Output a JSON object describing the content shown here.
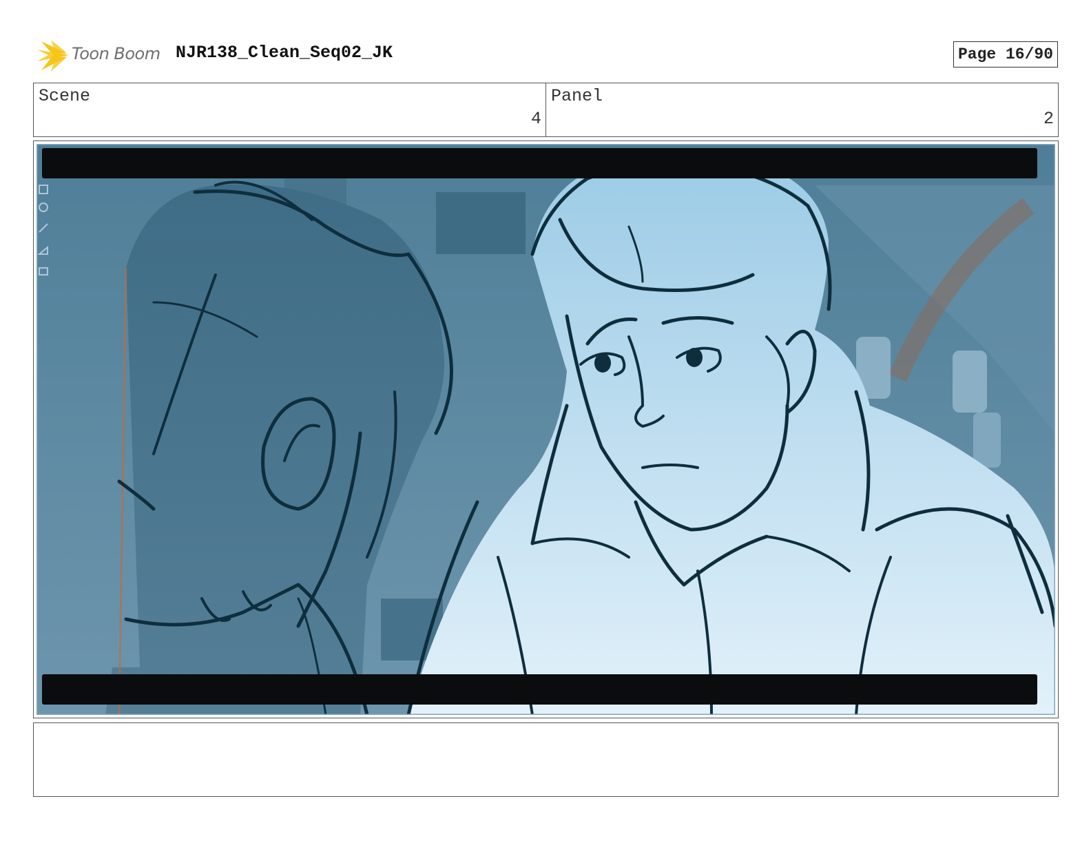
{
  "header": {
    "logo_text": "Toon Boom",
    "document_title": "NJR138_Clean_Seq02_JK",
    "page_label": "Page 16/90"
  },
  "info": {
    "scene_label": "Scene",
    "scene_value": "4",
    "panel_label": "Panel",
    "panel_value": "2"
  },
  "panel_image": {
    "icon": "storyboard-drawing",
    "letterbox_color": "#0b0c0d",
    "background_color": "#5b879f",
    "character_fill": "#a9d3ea",
    "line_color": "#0f2e3d"
  },
  "notes": {
    "text": ""
  },
  "colors": {
    "logo_yellow": "#f5c518",
    "border": "#555555"
  }
}
